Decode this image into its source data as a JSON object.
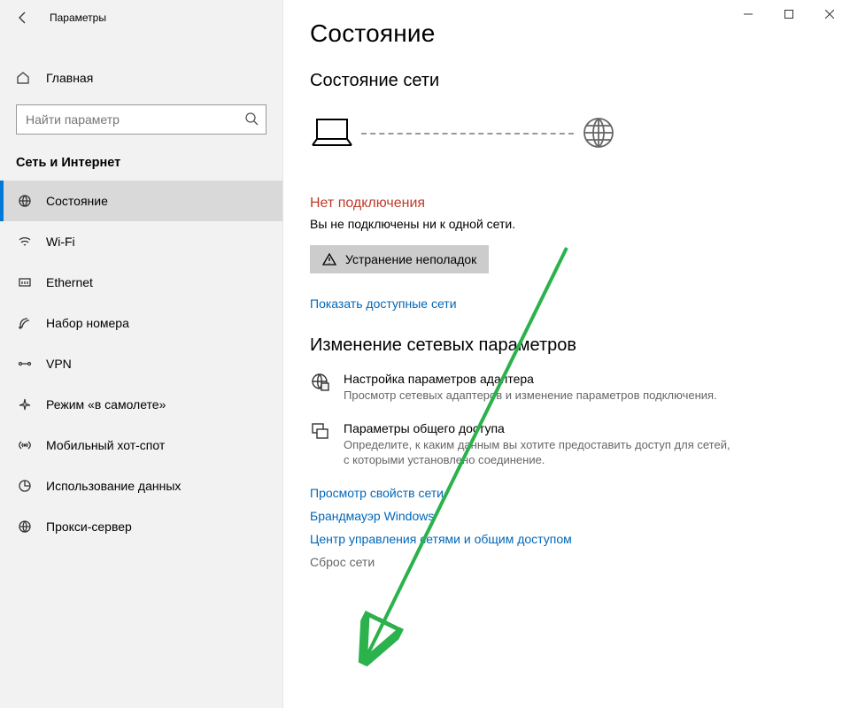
{
  "window": {
    "title": "Параметры"
  },
  "sidebar": {
    "home": "Главная",
    "search_placeholder": "Найти параметр",
    "section": "Сеть и Интернет",
    "items": [
      {
        "label": "Состояние"
      },
      {
        "label": "Wi-Fi"
      },
      {
        "label": "Ethernet"
      },
      {
        "label": "Набор номера"
      },
      {
        "label": "VPN"
      },
      {
        "label": "Режим «в самолете»"
      },
      {
        "label": "Мобильный хот-спот"
      },
      {
        "label": "Использование данных"
      },
      {
        "label": "Прокси-сервер"
      }
    ]
  },
  "main": {
    "page_title": "Состояние",
    "status_head": "Состояние сети",
    "no_conn_title": "Нет подключения",
    "no_conn_sub": "Вы не подключены ни к одной сети.",
    "troubleshoot": "Устранение неполадок",
    "show_networks": "Показать доступные сети",
    "change_head": "Изменение сетевых параметров",
    "adapter_title": "Настройка параметров адаптера",
    "adapter_desc": "Просмотр сетевых адаптеров и изменение параметров подключения.",
    "sharing_title": "Параметры общего доступа",
    "sharing_desc": "Определите, к каким данным вы хотите предоставить доступ для сетей, с которыми установлено соединение.",
    "link_props": "Просмотр свойств сети",
    "link_firewall": "Брандмауэр Windows",
    "link_center": "Центр управления сетями и общим доступом",
    "link_reset": "Сброс сети"
  }
}
